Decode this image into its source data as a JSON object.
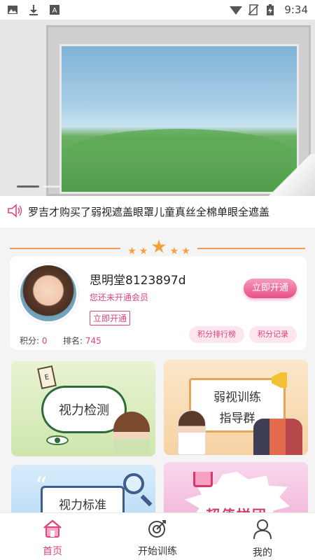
{
  "status_bar": {
    "time": "9:34",
    "left_icons": [
      "image-icon",
      "download-icon",
      "text-a-icon"
    ],
    "right_icons": [
      "wifi-icon",
      "no-sim-icon",
      "battery-charging-icon"
    ]
  },
  "banner": {
    "slide_count": 2,
    "active_slide": 1
  },
  "notice": {
    "icon": "speaker-icon",
    "text": "罗吉才购买了弱视遮盖眼罩儿童真丝全棉单眼全遮盖"
  },
  "user": {
    "name": "思明堂8123897d",
    "member_status": "您还未开通会员",
    "open_label": "立即开通",
    "open_button_label": "立即开通",
    "points_label": "积分: ",
    "points_value": "0",
    "rank_label": "排名: ",
    "rank_value": "745",
    "leaderboard_label": "积分排行榜",
    "points_record_label": "积分记录"
  },
  "features": {
    "vision_test": "视力检测",
    "group_line1": "弱视训练",
    "group_line2": "指导群",
    "vision_standard": "视力标准",
    "group_buy": "超值拼团"
  },
  "tabbar": {
    "items": [
      {
        "label": "首页",
        "icon": "home-icon",
        "active": true
      },
      {
        "label": "开始训练",
        "icon": "target-icon",
        "active": false
      },
      {
        "label": "我的",
        "icon": "user-icon",
        "active": false
      }
    ]
  },
  "colors": {
    "accent_pink": "#e0447c",
    "star_orange": "#f3a13a",
    "line_orange": "#f39a55"
  }
}
